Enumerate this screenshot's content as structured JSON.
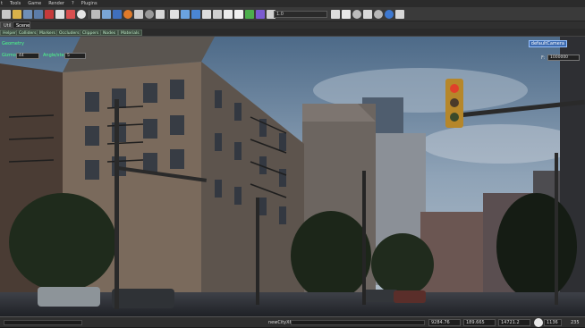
{
  "menubar": {
    "items": [
      "t",
      "Tools",
      "Game",
      "Render",
      "?",
      "Plugins"
    ]
  },
  "toolbar": {
    "zoom_value": "1.0"
  },
  "tabs": [
    {
      "label": "Util"
    },
    {
      "label": "Scene"
    }
  ],
  "subtabs": [
    "Helpers",
    "Colliders",
    "Markers",
    "Occluders",
    "Clippers",
    "Nodes",
    "Materials"
  ],
  "overlay": {
    "top_label": "Geometry",
    "field1_label": "Gizmo",
    "field1_value": "44",
    "field2_label": "Angle/step",
    "field2_value": "5",
    "camera_button": "defaultCamera",
    "fov_label": "F:",
    "fov_value": "1000000"
  },
  "status": {
    "scene_name": "newCityX6",
    "coord_x": "9284.76",
    "coord_y": "189.665",
    "coord_z": "14721.2",
    "fps": "1136",
    "ms": "235"
  }
}
